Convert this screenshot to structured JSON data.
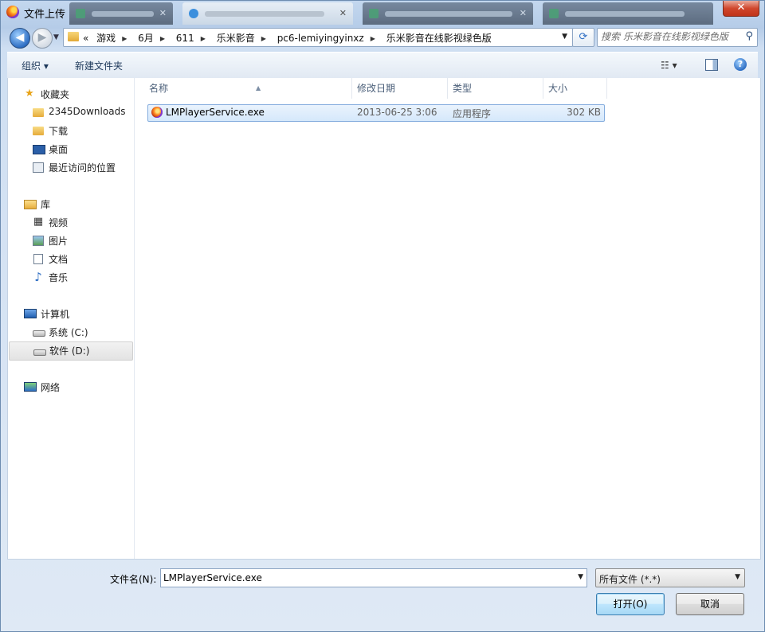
{
  "window": {
    "title": "文件上传",
    "close_glyph": "✕"
  },
  "nav": {
    "back_glyph": "◀",
    "forward_glyph": "▶",
    "path_overflow": "«",
    "breadcrumbs": [
      "游戏",
      "6月",
      "611",
      "乐米影音",
      "pc6-lemiyingyinxz",
      "乐米影音在线影视绿色版"
    ],
    "refresh_glyph": "⟳"
  },
  "search": {
    "placeholder": "搜索 乐米影音在线影视绿色版"
  },
  "toolbar": {
    "organize": "组织 ▾",
    "new_folder": "新建文件夹",
    "views": "☷ ▾",
    "help": "?"
  },
  "sidebar": {
    "favorites": {
      "label": "收藏夹",
      "items": [
        "2345Downloads",
        "下载",
        "桌面",
        "最近访问的位置"
      ]
    },
    "libraries": {
      "label": "库",
      "items": [
        "视频",
        "图片",
        "文档",
        "音乐"
      ]
    },
    "computer": {
      "label": "计算机",
      "items": [
        "系统 (C:)",
        "软件 (D:)"
      ]
    },
    "network": {
      "label": "网络"
    }
  },
  "columns": {
    "name": "名称",
    "modified": "修改日期",
    "type": "类型",
    "size": "大小"
  },
  "files": [
    {
      "name": "LMPlayerService.exe",
      "modified": "2013-06-25 3:06",
      "type": "应用程序",
      "size": "302 KB"
    }
  ],
  "bottom": {
    "filename_label": "文件名(N):",
    "filename_value": "LMPlayerService.exe",
    "filetype": "所有文件 (*.*)",
    "open": "打开(O)",
    "cancel": "取消"
  },
  "colors": {
    "selection_bg": "#d5e8fb",
    "selection_border": "#84acdd",
    "close_red": "#d0472d"
  }
}
